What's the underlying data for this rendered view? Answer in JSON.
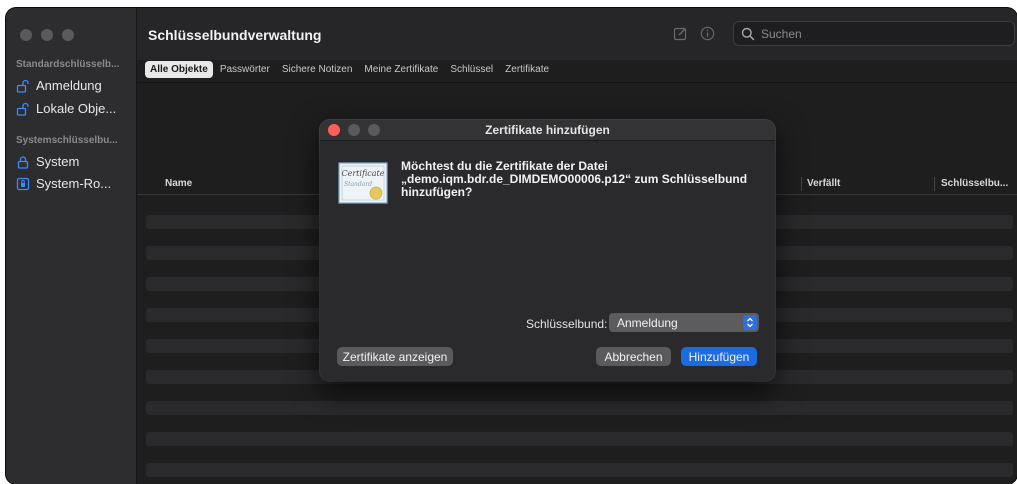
{
  "window": {
    "title": "Schlüsselbundverwaltung",
    "search_placeholder": "Suchen"
  },
  "sidebar": {
    "sections": [
      {
        "label": "Standardschlüsselb...",
        "items": [
          {
            "label": "Anmeldung",
            "icon": "unlocked-padlock-icon"
          },
          {
            "label": "Lokale Obje...",
            "icon": "unlocked-padlock-icon"
          }
        ]
      },
      {
        "label": "Systemschlüsselbu...",
        "items": [
          {
            "label": "System",
            "icon": "locked-padlock-icon"
          },
          {
            "label": "System-Ro...",
            "icon": "locked-safe-icon"
          }
        ]
      }
    ]
  },
  "tabs": [
    "Alle Objekte",
    "Passwörter",
    "Sichere Notizen",
    "Meine Zertifikate",
    "Schlüssel",
    "Zertifikate"
  ],
  "active_tab": "Alle Objekte",
  "columns": [
    "Name",
    "Verfällt",
    "Schlüsselbu..."
  ],
  "dialog": {
    "title": "Zertifikate hinzufügen",
    "message_line1": "Möchtest du die Zertifikate der Datei",
    "message_line2": "„demo.iqm.bdr.de_DIMDEMO00006.p12“ zum Schlüsselbund",
    "message_line3": "hinzufügen?",
    "keychain_label": "Schlüsselbund:",
    "keychain_value": "Anmeldung",
    "show_certs_button": "Zertifikate anzeigen",
    "cancel_button": "Abbrechen",
    "add_button": "Hinzufügen",
    "certificate_icon_text_1": "Certificate",
    "certificate_icon_text_2": "Standard"
  },
  "colors": {
    "accent": "#1b6ce0",
    "window_bg": "#1e1e1e",
    "sidebar_bg": "#2d2d2f",
    "dialog_bg": "#2a2a2c"
  }
}
